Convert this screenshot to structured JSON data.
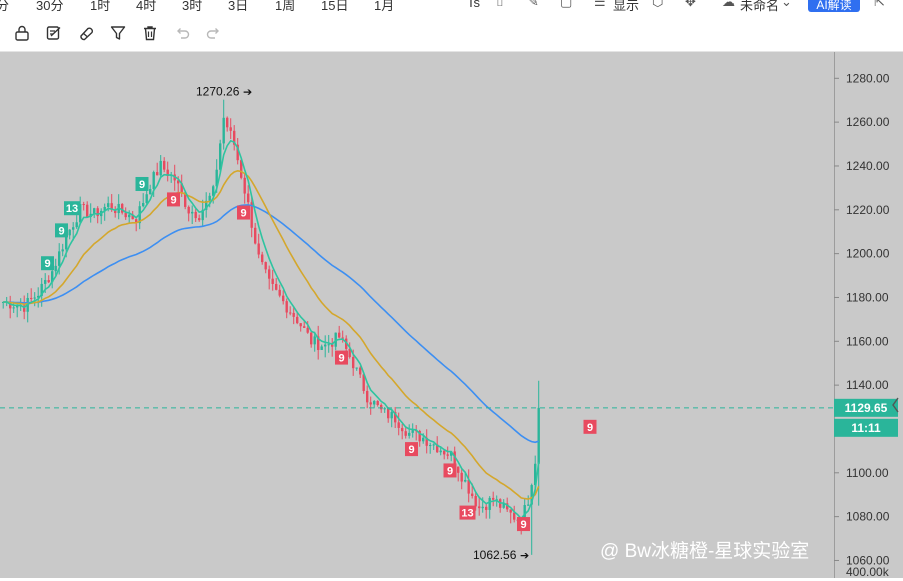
{
  "timeframes": [
    "分",
    "30分",
    "1时",
    "4时",
    "3时",
    "3日",
    "1周",
    "15日",
    "1月"
  ],
  "header_right": {
    "ts_label": "Ts",
    "display_label": "显示",
    "template_label": "未命名",
    "ai_button": "AI解读"
  },
  "toolbar_icons": [
    "lock-icon",
    "edit-icon",
    "magnet-icon",
    "filter-icon",
    "trash-icon",
    "undo-icon",
    "redo-icon"
  ],
  "chart_data": {
    "type": "candlestick",
    "ylim": [
      1052,
      1292
    ],
    "y_ticks": [
      "1280.00",
      "1260.00",
      "1240.00",
      "1220.00",
      "1200.00",
      "1180.00",
      "1160.00",
      "1140.00",
      "1100.00",
      "1080.00",
      "1060.00"
    ],
    "y_tick_values": [
      1280,
      1260,
      1240,
      1220,
      1200,
      1180,
      1160,
      1140,
      1100,
      1080,
      1060
    ],
    "bottom_tick": "400.00k",
    "current_price": 1129.65,
    "current_price_label": "1129.65",
    "countdown_label": "11:11",
    "high": {
      "value": 1270.26,
      "label": "1270.26"
    },
    "low": {
      "value": 1062.56,
      "label": "1062.56"
    },
    "td_markers": [
      {
        "i": 13,
        "label": "9",
        "side": "up"
      },
      {
        "i": 17,
        "label": "9",
        "side": "up"
      },
      {
        "i": 20,
        "label": "13",
        "side": "up"
      },
      {
        "i": 40,
        "label": "9",
        "side": "up"
      },
      {
        "i": 49,
        "label": "9",
        "side": "down"
      },
      {
        "i": 69,
        "label": "9",
        "side": "down"
      },
      {
        "i": 97,
        "label": "9",
        "side": "down"
      },
      {
        "i": 117,
        "label": "9",
        "side": "down"
      },
      {
        "i": 128,
        "label": "9",
        "side": "down"
      },
      {
        "i": 133,
        "label": "13",
        "side": "down"
      },
      {
        "i": 149,
        "label": "9",
        "side": "down"
      },
      {
        "i": 168,
        "label": "9",
        "side": "down"
      }
    ],
    "price_path": [
      [
        0,
        1178
      ],
      [
        6,
        1176
      ],
      [
        10,
        1182
      ],
      [
        14,
        1192
      ],
      [
        18,
        1208
      ],
      [
        22,
        1220
      ],
      [
        26,
        1218
      ],
      [
        30,
        1222
      ],
      [
        34,
        1219
      ],
      [
        38,
        1216
      ],
      [
        42,
        1232
      ],
      [
        45,
        1240
      ],
      [
        49,
        1234
      ],
      [
        53,
        1220
      ],
      [
        56,
        1218
      ],
      [
        60,
        1228
      ],
      [
        63,
        1262
      ],
      [
        66,
        1250
      ],
      [
        70,
        1222
      ],
      [
        73,
        1198
      ],
      [
        76,
        1186
      ],
      [
        80,
        1178
      ],
      [
        84,
        1170
      ],
      [
        88,
        1160
      ],
      [
        92,
        1158
      ],
      [
        96,
        1162
      ],
      [
        100,
        1150
      ],
      [
        104,
        1135
      ],
      [
        108,
        1128
      ],
      [
        112,
        1125
      ],
      [
        116,
        1118
      ],
      [
        120,
        1116
      ],
      [
        124,
        1112
      ],
      [
        128,
        1108
      ],
      [
        132,
        1096
      ],
      [
        136,
        1084
      ],
      [
        140,
        1088
      ],
      [
        144,
        1082
      ],
      [
        148,
        1078
      ],
      [
        150,
        1088
      ],
      [
        152,
        1106
      ],
      [
        153,
        1126
      ]
    ],
    "ma_fast_color": "#2ec4a0",
    "ma_mid_color": "#d4a72c",
    "ma_slow_color": "#3d8ff2",
    "up_color": "#2ab59a",
    "down_color": "#e84a5f"
  },
  "watermark": "@ Bw冰糖橙-星球实验室"
}
